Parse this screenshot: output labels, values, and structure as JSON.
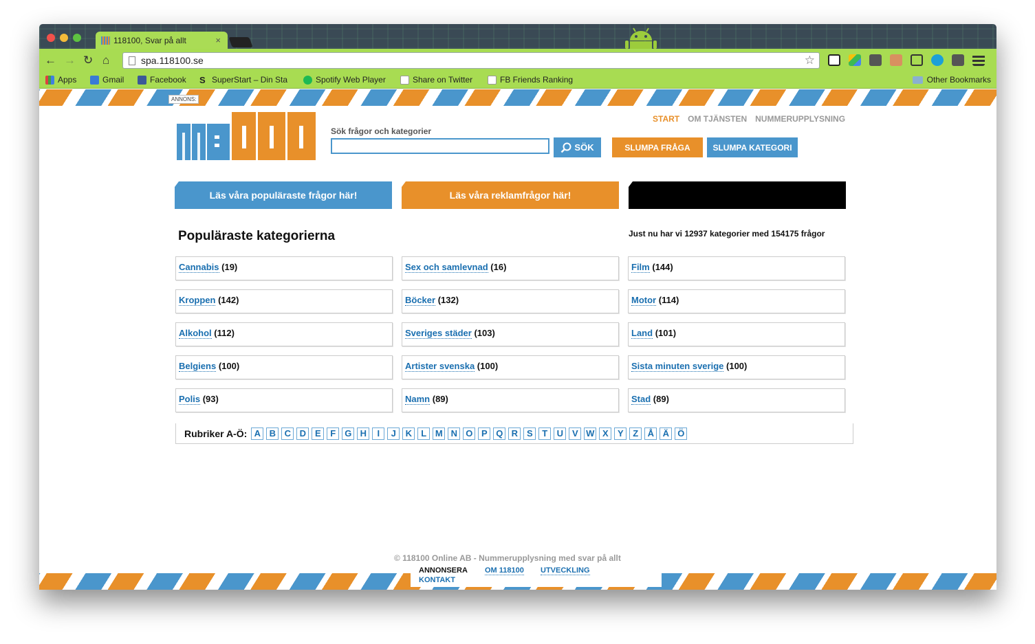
{
  "browser": {
    "tab_title": "118100, Svar på allt",
    "tab_close": "×",
    "url": "spa.118100.se",
    "bookmarks": [
      {
        "label": "Apps",
        "color": "#e04040"
      },
      {
        "label": "Gmail",
        "color": "#3a7bd5"
      },
      {
        "label": "Facebook",
        "color": "#3b5998"
      },
      {
        "label": "SuperStart – Din Sta",
        "color": "#333333"
      },
      {
        "label": "Spotify Web Player",
        "color": "#1db954"
      },
      {
        "label": "Share on Twitter",
        "color": "#dddddd"
      },
      {
        "label": "FB Friends Ranking",
        "color": "#dddddd"
      }
    ],
    "other_bookmarks": "Other Bookmarks"
  },
  "ad_label": "ANNONS:",
  "logo": {
    "digits": [
      "1",
      "1",
      "8",
      "1",
      "0",
      "0"
    ]
  },
  "search": {
    "label": "Sök frågor och kategorier",
    "value": "",
    "button": "SÖK"
  },
  "buttons": {
    "random_question": "SLUMPA FRÅGA",
    "random_category": "SLUMPA KATEGORI"
  },
  "topnav": [
    "START",
    "OM TJÄNSTEN",
    "NUMMERUPPLYSNING"
  ],
  "banners": {
    "popular": "Läs våra populäraste frågor här!",
    "ads": "Läs våra reklamfrågor här!",
    "third": ""
  },
  "heading": "Populäraste kategorierna",
  "stats": "Just nu har vi 12937 kategorier med 154175 frågor",
  "categories": [
    {
      "name": "Cannabis",
      "count": "(19)"
    },
    {
      "name": "Sex och samlevnad",
      "count": "(16)"
    },
    {
      "name": "Film",
      "count": "(144)"
    },
    {
      "name": "Kroppen",
      "count": "(142)"
    },
    {
      "name": "Böcker",
      "count": "(132)"
    },
    {
      "name": "Motor",
      "count": "(114)"
    },
    {
      "name": "Alkohol",
      "count": "(112)"
    },
    {
      "name": "Sveriges städer",
      "count": "(103)"
    },
    {
      "name": "Land",
      "count": "(101)"
    },
    {
      "name": "Belgiens",
      "count": "(100)"
    },
    {
      "name": "Artister svenska",
      "count": "(100)"
    },
    {
      "name": "Sista minuten sverige",
      "count": "(100)"
    },
    {
      "name": "Polis",
      "count": "(93)"
    },
    {
      "name": "Namn",
      "count": "(89)"
    },
    {
      "name": "Stad",
      "count": "(89)"
    }
  ],
  "alphabet": {
    "label": "Rubriker A-Ö:",
    "letters": [
      "A",
      "B",
      "C",
      "D",
      "E",
      "F",
      "G",
      "H",
      "I",
      "J",
      "K",
      "L",
      "M",
      "N",
      "O",
      "P",
      "Q",
      "R",
      "S",
      "T",
      "U",
      "V",
      "W",
      "X",
      "Y",
      "Z",
      "Å",
      "Ä",
      "Ö"
    ]
  },
  "footer": {
    "copyright": "© 118100 Online AB - Nummerupplysning med svar på allt",
    "links": [
      "ANNONSERA",
      "OM 118100",
      "UTVECKLING",
      "KONTAKT"
    ]
  },
  "colors": {
    "orange": "#e8902a",
    "blue": "#4a96cc",
    "browser_green": "#a8dc52"
  }
}
